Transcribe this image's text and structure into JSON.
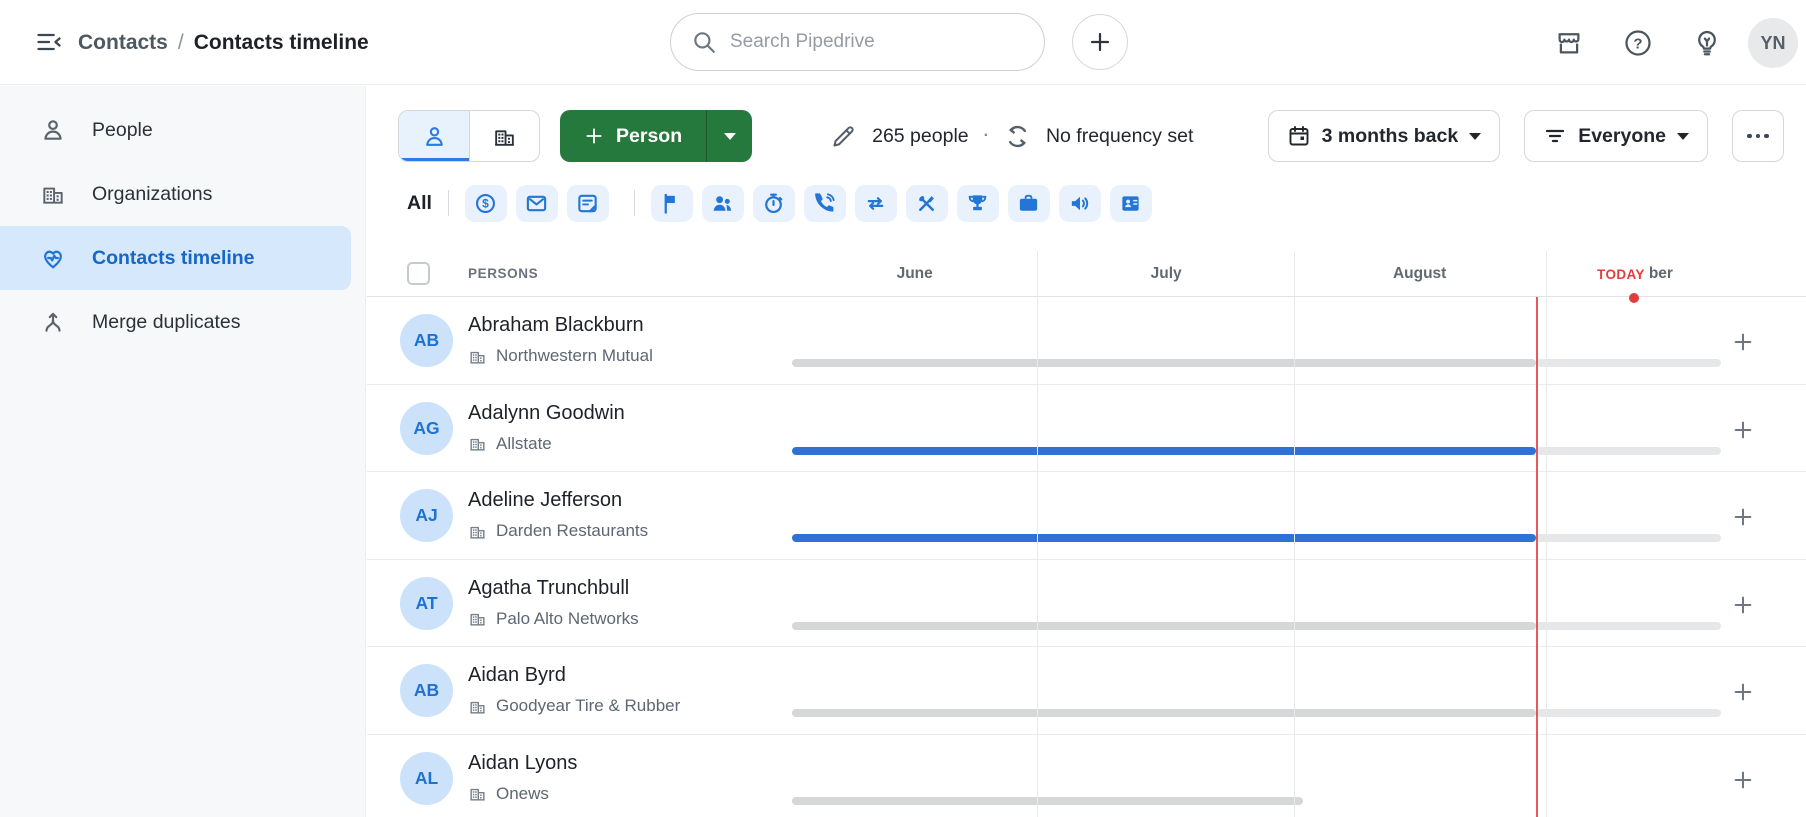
{
  "topbar": {
    "breadcrumb": {
      "parent": "Contacts",
      "separator": "/",
      "current": "Contacts timeline"
    },
    "search": {
      "placeholder": "Search Pipedrive"
    },
    "user_initials": "YN"
  },
  "sidebar": {
    "items": [
      {
        "label": "People",
        "icon": "person",
        "active": false
      },
      {
        "label": "Organizations",
        "icon": "organization-building",
        "active": false
      },
      {
        "label": "Contacts timeline",
        "icon": "heart-pulse",
        "active": true
      },
      {
        "label": "Merge duplicates",
        "icon": "merge-arrows",
        "active": false
      }
    ]
  },
  "toolbar": {
    "entity_toggle_icons": [
      "person",
      "organization"
    ],
    "add_button_label": "Person",
    "people_count": "265 people",
    "dot_separator": "·",
    "frequency_status": "No frequency set",
    "date_range_label": "3 months back",
    "visibility_filter_label": "Everyone"
  },
  "filter_bar": {
    "all_label": "All",
    "activity_icons": [
      "deal",
      "email",
      "note",
      "flag",
      "meeting",
      "deadline",
      "call",
      "sync",
      "lunch",
      "trophy",
      "briefcase",
      "audio",
      "contact-card"
    ]
  },
  "timeline": {
    "columns_label": "PERSONS",
    "months": [
      "June",
      "July",
      "August"
    ],
    "partial_month_text": "ber",
    "today_label": "TODAY",
    "rows": [
      {
        "initials": "AB",
        "name": "Abraham Blackburn",
        "organization": "Northwestern Mutual",
        "segments": [
          {
            "type": "past-inactive",
            "start_pct": 0,
            "end_pct": 73.4
          },
          {
            "type": "future",
            "start_pct": 73.4,
            "end_pct": 91.6
          }
        ]
      },
      {
        "initials": "AG",
        "name": "Adalynn Goodwin",
        "organization": "Allstate",
        "segments": [
          {
            "type": "active",
            "start_pct": 0,
            "end_pct": 73.4
          },
          {
            "type": "future",
            "start_pct": 73.4,
            "end_pct": 91.6
          }
        ]
      },
      {
        "initials": "AJ",
        "name": "Adeline Jefferson",
        "organization": "Darden Restaurants",
        "segments": [
          {
            "type": "active",
            "start_pct": 0,
            "end_pct": 73.4
          },
          {
            "type": "future",
            "start_pct": 73.4,
            "end_pct": 91.6
          }
        ]
      },
      {
        "initials": "AT",
        "name": "Agatha Trunchbull",
        "organization": "Palo Alto Networks",
        "segments": [
          {
            "type": "past-inactive",
            "start_pct": 0,
            "end_pct": 73.4
          },
          {
            "type": "future",
            "start_pct": 73.4,
            "end_pct": 91.6
          }
        ]
      },
      {
        "initials": "AB",
        "name": "Aidan Byrd",
        "organization": "Goodyear Tire & Rubber",
        "segments": [
          {
            "type": "past-inactive",
            "start_pct": 0,
            "end_pct": 73.4
          },
          {
            "type": "future",
            "start_pct": 73.4,
            "end_pct": 91.6
          }
        ]
      },
      {
        "initials": "AL",
        "name": "Aidan Lyons",
        "organization": "Onews",
        "segments": [
          {
            "type": "past-inactive",
            "start_pct": 0,
            "end_pct": 50.4
          }
        ]
      }
    ]
  },
  "colors": {
    "accent_blue": "#317ae2",
    "primary_green": "#26793c",
    "today_red": "#e23d3d",
    "bar_active_blue": "#3071d9",
    "bar_inactive_gray": "#d5d7d9",
    "bar_future_gray": "#e6e7e9",
    "selected_nav_bg": "#d6e8fc"
  }
}
